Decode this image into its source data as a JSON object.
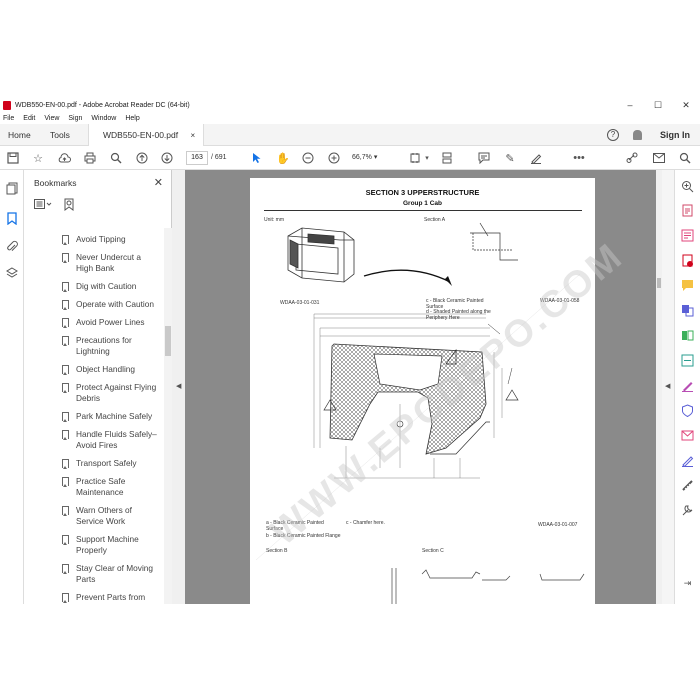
{
  "window": {
    "title": "WDB550-EN-00.pdf - Adobe Acrobat Reader DC (64-bit)",
    "minimize": "–",
    "maximize": "☐",
    "close": "✕"
  },
  "menu": [
    "File",
    "Edit",
    "View",
    "Sign",
    "Window",
    "Help"
  ],
  "tabs": {
    "home": "Home",
    "tools": "Tools",
    "document": "WDB550-EN-00.pdf",
    "document_close": "×",
    "help": "?",
    "signin": "Sign In"
  },
  "toolbar": {
    "current_page": "163",
    "page_total": "/ 691",
    "zoom": "66,7%"
  },
  "bookmarks": {
    "title": "Bookmarks",
    "close": "✕",
    "items": [
      "Avoid Tipping",
      "Never Undercut a High Bank",
      "Dig with Caution",
      "Operate with Caution",
      "Avoid Power Lines",
      "Precautions for Lightning",
      "Object Handling",
      "Protect Against Flying Debris",
      "Park Machine Safely",
      "Handle Fluids Safely–Avoid Fires",
      "Transport Safely",
      "Practice Safe Maintenance",
      "Warn Others of Service Work",
      "Support Machine Properly",
      "Stay Clear of Moving Parts",
      "Prevent Parts from Flying"
    ]
  },
  "page": {
    "section": "SECTION 3 UPPERSTRUCTURE",
    "group": "Group 1 Cab",
    "unit": "Unit: mm",
    "section_a": "Section A",
    "section_b": "Section B",
    "section_c": "Section C",
    "fig1": "WDAA-03-01-031",
    "fig2": "WDAA-03-01-058",
    "fig3": "WDAA-03-01-007",
    "note_c": "c -  Black Ceramic Painted Surface",
    "note_d": "d -  Shaded Painted along the Periphery Here",
    "note_a": "a -  Black Ceramic Painted Surface",
    "note_b": "b -  Black Ceramic Painted Flange",
    "note_c2": "c -  Chamfer here.",
    "watermark": "WWW.EPCDEPO.COM"
  },
  "colors": {
    "accent": "#1473e6",
    "pdf_red": "#d0021b",
    "doc_bg": "#8a8a8a"
  }
}
